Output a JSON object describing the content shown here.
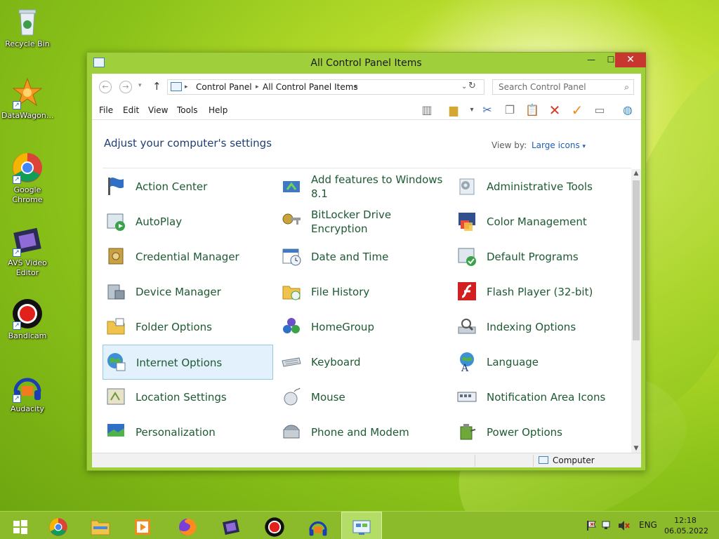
{
  "desktop": {
    "icons": [
      {
        "label": "Recycle Bin",
        "icon": "recycle-bin-icon"
      },
      {
        "label": "DataWagon...",
        "icon": "datawagon-icon"
      },
      {
        "label": "Google Chrome",
        "icon": "chrome-icon"
      },
      {
        "label": "AVS Video Editor",
        "icon": "film-icon"
      },
      {
        "label": "Bandicam",
        "icon": "record-icon"
      },
      {
        "label": "Audacity",
        "icon": "headphones-icon"
      }
    ]
  },
  "window": {
    "title": "All Control Panel Items",
    "buttons": {
      "minimize": "—",
      "maximize": "☐",
      "close": "✕"
    },
    "address": {
      "crumb1": "Control Panel",
      "crumb2": "All Control Panel Items"
    },
    "search_placeholder": "Search Control Panel",
    "menu": [
      "File",
      "Edit",
      "View",
      "Tools",
      "Help"
    ],
    "heading": "Adjust your computer's settings",
    "view_by_label": "View by:",
    "view_by_value": "Large icons",
    "items": [
      {
        "label": "Action Center",
        "icon": "flag-icon"
      },
      {
        "label": "Add features to Windows 8.1",
        "icon": "add-features-icon"
      },
      {
        "label": "Administrative Tools",
        "icon": "admin-tools-icon"
      },
      {
        "label": "AutoPlay",
        "icon": "autoplay-icon"
      },
      {
        "label": "BitLocker Drive Encryption",
        "icon": "key-icon"
      },
      {
        "label": "Color Management",
        "icon": "color-management-icon"
      },
      {
        "label": "Credential Manager",
        "icon": "safe-icon"
      },
      {
        "label": "Date and Time",
        "icon": "calendar-clock-icon"
      },
      {
        "label": "Default Programs",
        "icon": "default-programs-icon"
      },
      {
        "label": "Device Manager",
        "icon": "device-manager-icon"
      },
      {
        "label": "File History",
        "icon": "file-history-icon"
      },
      {
        "label": "Flash Player (32-bit)",
        "icon": "flash-icon"
      },
      {
        "label": "Folder Options",
        "icon": "folder-icon"
      },
      {
        "label": "HomeGroup",
        "icon": "homegroup-icon"
      },
      {
        "label": "Indexing Options",
        "icon": "indexing-icon"
      },
      {
        "label": "Internet Options",
        "icon": "globe-icon"
      },
      {
        "label": "Keyboard",
        "icon": "keyboard-icon"
      },
      {
        "label": "Language",
        "icon": "language-icon"
      },
      {
        "label": "Location Settings",
        "icon": "location-icon"
      },
      {
        "label": "Mouse",
        "icon": "mouse-icon"
      },
      {
        "label": "Notification Area Icons",
        "icon": "notification-area-icon"
      },
      {
        "label": "Personalization",
        "icon": "personalization-icon"
      },
      {
        "label": "Phone and Modem",
        "icon": "phone-icon"
      },
      {
        "label": "Power Options",
        "icon": "power-icon"
      }
    ],
    "selected_item": "Internet Options",
    "status": "Computer"
  },
  "taskbar": {
    "apps": [
      "start-icon",
      "chrome-icon",
      "file-explorer-icon",
      "media-player-icon",
      "firefox-icon",
      "film-icon",
      "record-icon",
      "headphones-icon",
      "control-panel-icon"
    ],
    "language": "ENG",
    "time": "12:18",
    "date": "06.05.2022"
  }
}
